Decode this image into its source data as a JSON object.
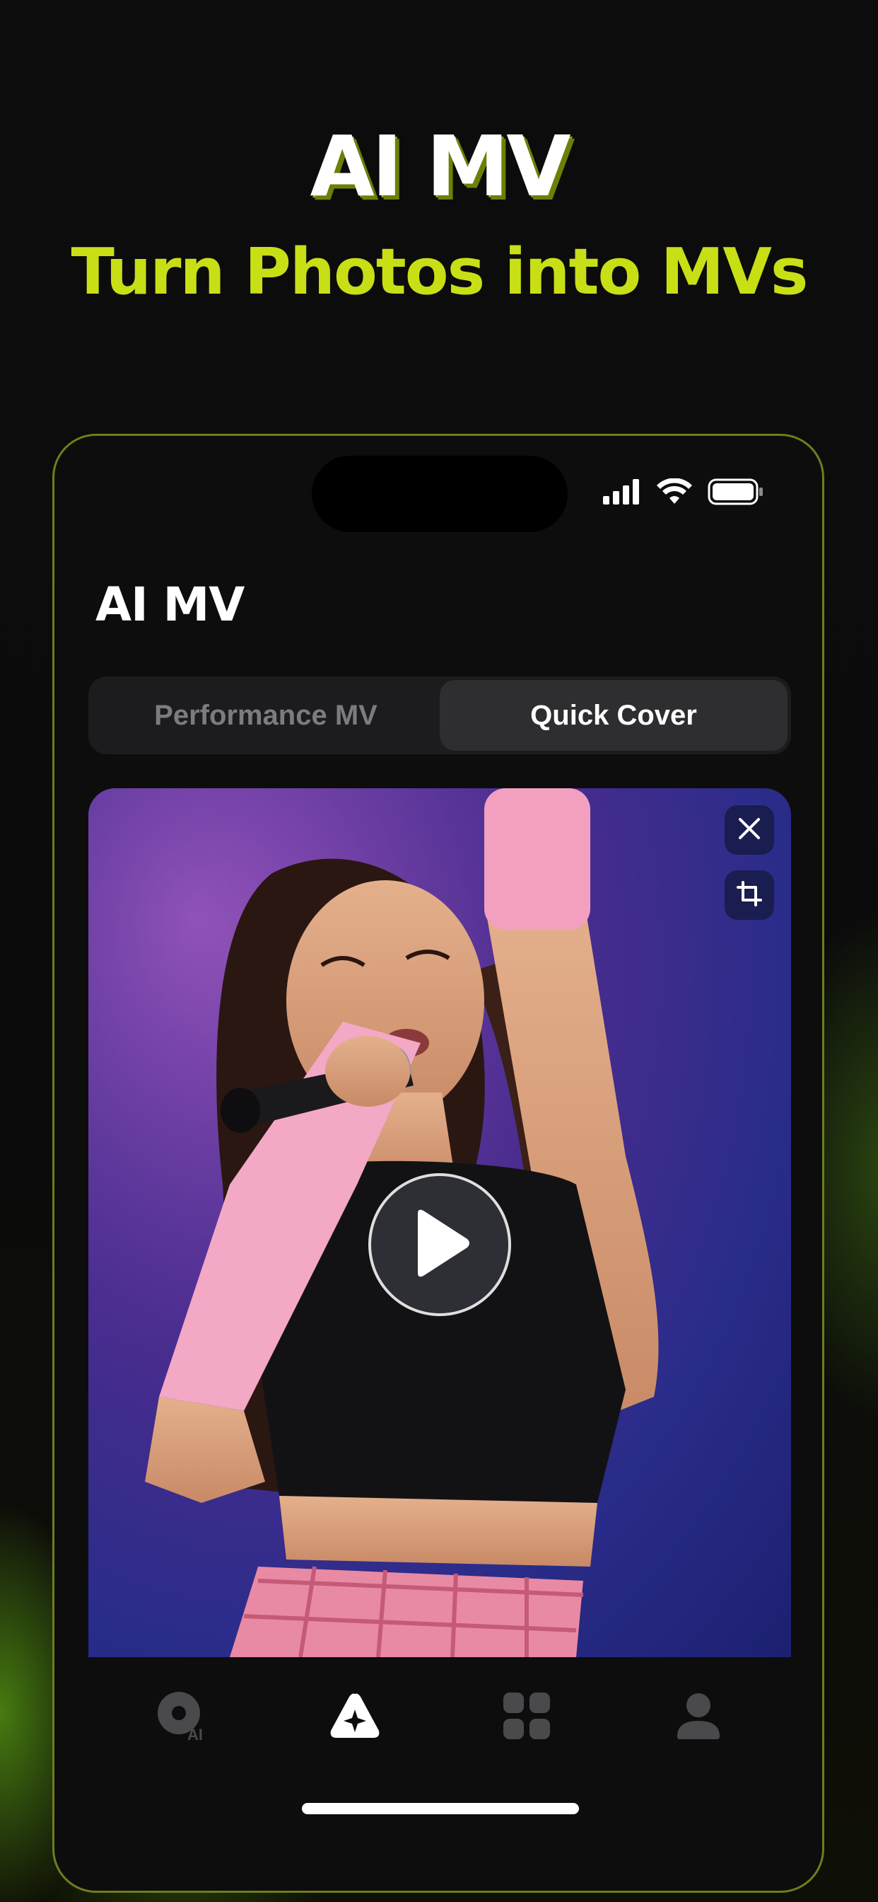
{
  "hero": {
    "title": "AI MV",
    "subtitle": "Turn Photos into MVs"
  },
  "app": {
    "title": "AI MV"
  },
  "segmented": {
    "tabs": [
      "Performance MV",
      "Quick Cover"
    ],
    "selected": "Quick Cover"
  },
  "media": {
    "close_icon": "close-icon",
    "crop_icon": "crop-icon",
    "play_icon": "play-icon"
  },
  "tabbar": {
    "items": [
      {
        "icon": "music-ai-icon",
        "label": "AI"
      },
      {
        "icon": "sparkle-triangle-icon"
      },
      {
        "icon": "grid-icon"
      },
      {
        "icon": "profile-icon"
      }
    ],
    "selected_index": 1
  },
  "colors": {
    "accent": "#c8df16",
    "background": "#0b0b0b",
    "phone_border": "#6f7d1c"
  }
}
